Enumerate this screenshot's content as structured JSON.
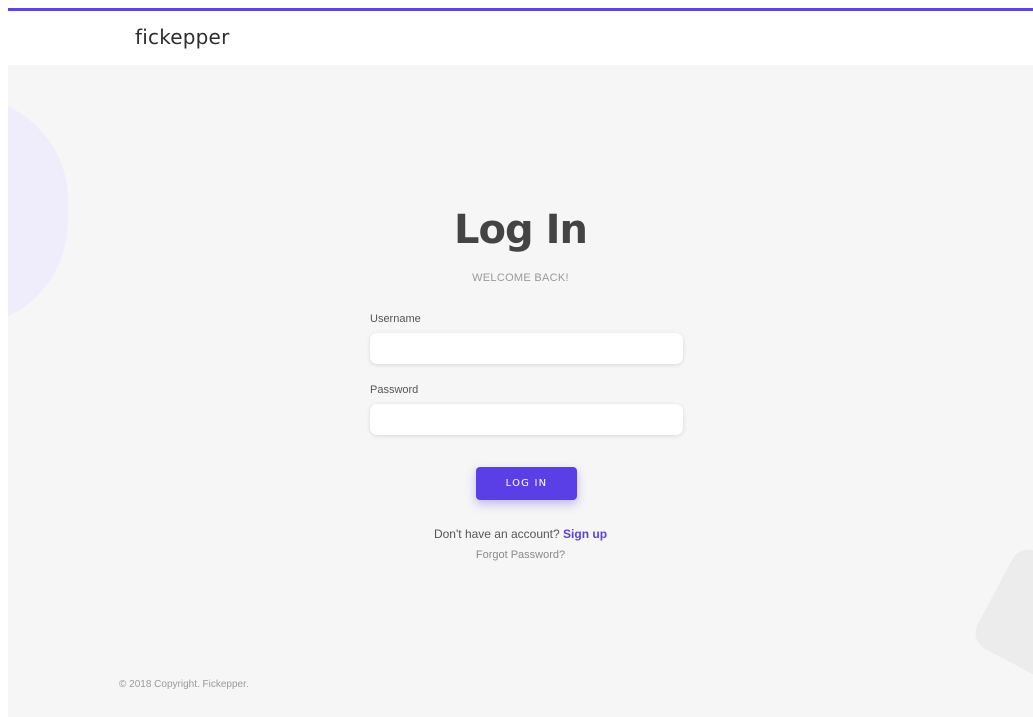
{
  "brand": {
    "logo_text": "fickepper",
    "accent_color": "#5b45e0"
  },
  "login": {
    "title": "Log In",
    "subtitle": "WELCOME BACK!",
    "username_label": "Username",
    "username_value": "",
    "password_label": "Password",
    "password_value": "",
    "submit_label": "LOG IN",
    "button_color": "#5b3fe6",
    "signup_prompt": "Don't have an account?",
    "signup_link": "Sign up",
    "forgot_link": "Forgot Password?"
  },
  "footer": {
    "copyright": "© 2018 Copyright. Fickepper."
  }
}
